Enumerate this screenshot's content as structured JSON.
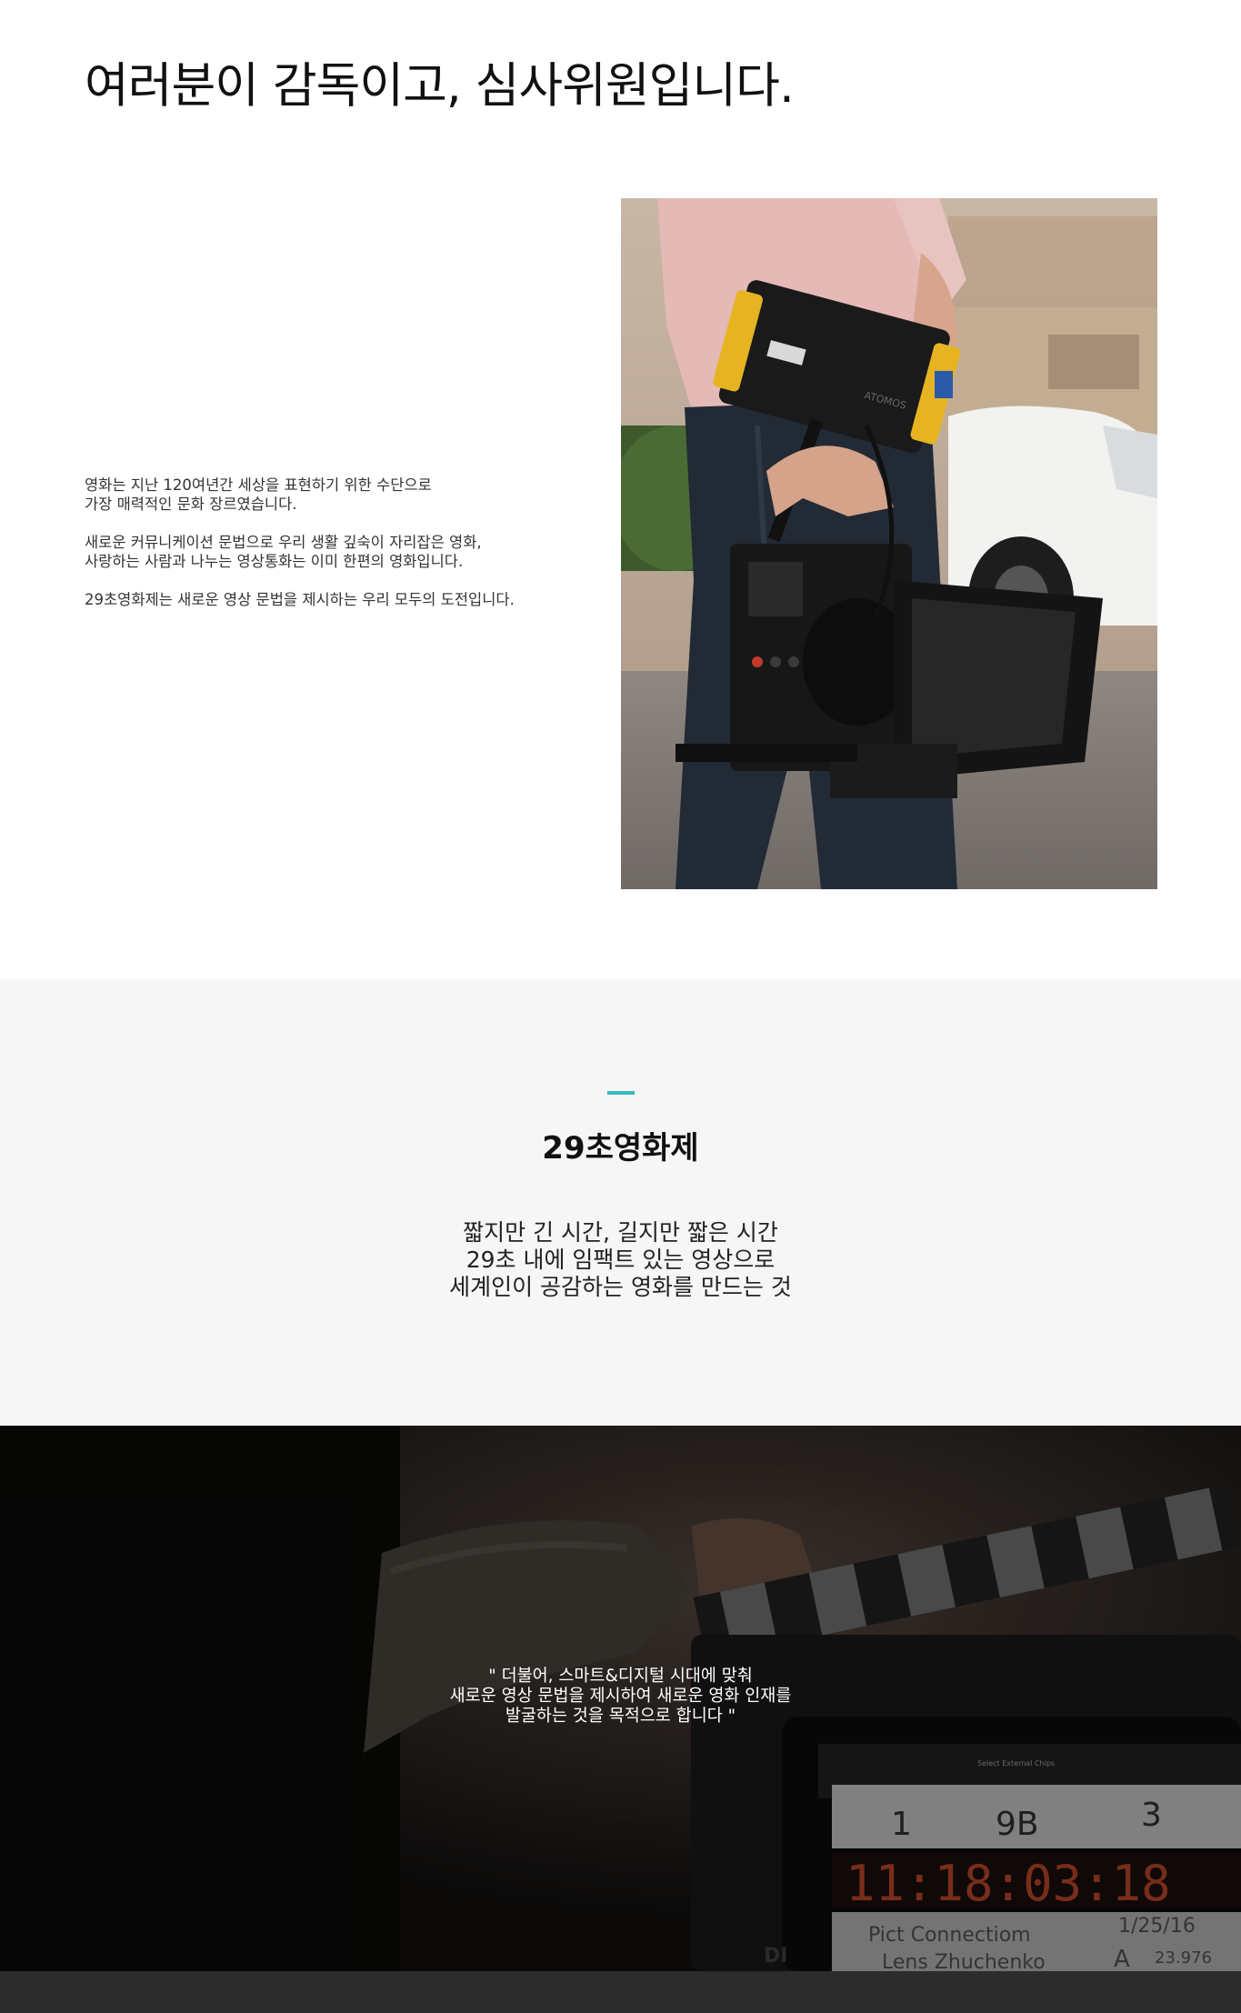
{
  "intro": {
    "heading": "여러분이 감독이고, 심사위원입니다.",
    "paragraphs": [
      "영화는 지난 120여년간 세상을 표현하기 위한 수단으로\n가장 매력적인 문화 장르였습니다.",
      "새로운 커뮤니케이션 문법으로 우리 생활 깊숙이 자리잡은 영화,\n사랑하는 사람과 나누는 영상통화는 이미 한편의 영화입니다.",
      "29초영화제는 새로운 영상 문법을 제시하는 우리 모두의 도전입니다."
    ],
    "camera_monitor_label": "ATOMOS"
  },
  "about": {
    "accent_color": "#3ab8c2",
    "title": "29초영화제",
    "lines": [
      "짧지만 긴 시간, 길지만 짧은 시간",
      "29초 내에 임팩트 있는 영상으로",
      "세계인이 공감하는 영화를 만드는 것"
    ]
  },
  "quote": {
    "lines": [
      "\" 더불어, 스마트&디지털 시대에 맞춰",
      "새로운 영상 문법을 제시하여 새로운 영화 인재를",
      "발굴하는 것을 목적으로 합니다 \""
    ],
    "clapper": {
      "header": "Select External Chips",
      "row1": [
        "1",
        "9B",
        "3"
      ],
      "timecode": "11:18:03:18",
      "row3": [
        "Pict Connectiom",
        "1/25/16"
      ],
      "row4": [
        "Lens Zhuchenko",
        "A",
        "23.976"
      ],
      "left_label": "DI"
    }
  }
}
